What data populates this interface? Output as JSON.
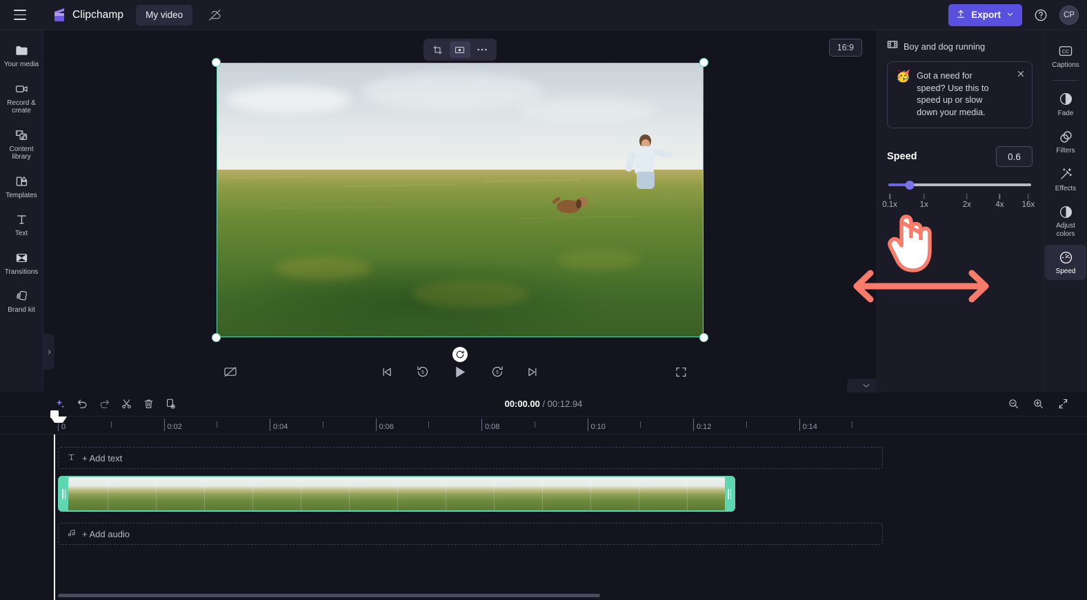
{
  "topbar": {
    "menu_icon": "hamburger-icon",
    "brand": "Clipchamp",
    "project_tab": "My video",
    "cloud_icon": "cloud-off-icon",
    "export_label": "Export",
    "help_icon": "help-circle-icon",
    "avatar_initials": "CP"
  },
  "left_rail": [
    {
      "label": "Your media",
      "icon": "folder-icon"
    },
    {
      "label": "Record & create",
      "icon": "video-camera-icon"
    },
    {
      "label": "Content library",
      "icon": "library-icon"
    },
    {
      "label": "Templates",
      "icon": "templates-icon"
    },
    {
      "label": "Text",
      "icon": "text-icon"
    },
    {
      "label": "Transitions",
      "icon": "transitions-icon"
    },
    {
      "label": "Brand kit",
      "icon": "brand-kit-icon"
    }
  ],
  "stage": {
    "crop_icon": "crop-icon",
    "fit_icon": "fit-to-frame-icon",
    "more_icon": "more-options-icon",
    "aspect_ratio": "16:9",
    "rotate_icon": "rotate-icon",
    "preview_alt": "Boy and dog running through a grass field"
  },
  "player": {
    "captions_off_icon": "captions-off-icon",
    "skip_back_icon": "skip-to-start-icon",
    "rewind_icon": "rewind-5s-icon",
    "play_icon": "play-icon",
    "forward_icon": "forward-5s-icon",
    "skip_forward_icon": "skip-to-end-icon",
    "fullscreen_icon": "fullscreen-icon"
  },
  "properties": {
    "clip_icon": "film-strip-icon",
    "clip_name": "Boy and dog running",
    "tip": {
      "emoji": "🥳",
      "text": "Got a need for speed? Use this to speed up or slow down your media.",
      "close_icon": "close-icon"
    },
    "speed_label": "Speed",
    "speed_value": "0.6",
    "slider": {
      "thumb_percent": 15,
      "ticks": [
        {
          "label": "0.1x",
          "percent": 1
        },
        {
          "label": "1x",
          "percent": 25
        },
        {
          "label": "2x",
          "percent": 55
        },
        {
          "label": "4x",
          "percent": 78
        },
        {
          "label": "16x",
          "percent": 98
        }
      ]
    },
    "annotation": {
      "hand_cursor_icon": "hand-pointer-cursor",
      "drag_arrow_icon": "left-right-drag-arrow",
      "accent_color": "#fa7b6a"
    }
  },
  "right_rail": [
    {
      "label": "Captions",
      "icon": "closed-captions-icon",
      "active": false
    },
    {
      "label": "Fade",
      "icon": "fade-icon",
      "active": false
    },
    {
      "label": "Filters",
      "icon": "filters-icon",
      "active": false
    },
    {
      "label": "Effects",
      "icon": "effects-wand-icon",
      "active": false
    },
    {
      "label": "Adjust colors",
      "icon": "adjust-colors-icon",
      "active": false
    },
    {
      "label": "Speed",
      "icon": "speedometer-icon",
      "active": true
    }
  ],
  "timeline": {
    "collapse_icon": "chevron-down-icon",
    "toolbar": [
      {
        "name": "magic-ai-button",
        "icon": "sparkle-icon"
      },
      {
        "name": "undo-button",
        "icon": "undo-icon"
      },
      {
        "name": "redo-button",
        "icon": "redo-icon"
      },
      {
        "name": "split-button",
        "icon": "scissors-icon"
      },
      {
        "name": "delete-button",
        "icon": "trash-icon"
      },
      {
        "name": "duplicate-button",
        "icon": "duplicate-icon"
      }
    ],
    "current_time": "00:00.00",
    "separator": "/",
    "total_time": "00:12.94",
    "zoom_out_icon": "zoom-out-icon",
    "zoom_in_icon": "zoom-in-icon",
    "fit_timeline_icon": "fit-timeline-icon",
    "ruler_labels": [
      "0",
      "0:02",
      "0:04",
      "0:06",
      "0:08",
      "0:10",
      "0:12",
      "0:14"
    ],
    "text_track": {
      "label": "+ Add text",
      "icon": "text-icon"
    },
    "audio_track": {
      "label": "+ Add audio",
      "icon": "music-note-icon"
    },
    "video_clip": {
      "name": "Boy and dog running",
      "selected": true
    }
  },
  "colors": {
    "accent_purple": "#5a50e0",
    "selection_teal": "#5ed6b0",
    "annotation_coral": "#fa7b6a",
    "panel_bg": "#1b1b28",
    "app_bg": "#14141f"
  }
}
